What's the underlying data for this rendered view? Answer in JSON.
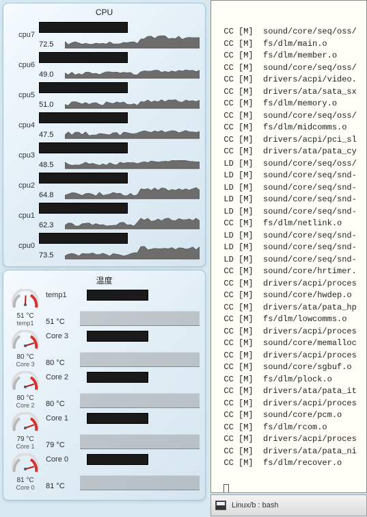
{
  "cpu_widget": {
    "title": "CPU",
    "rows": [
      {
        "label": "cpu7",
        "value": "72.5"
      },
      {
        "label": "cpu6",
        "value": "49.0"
      },
      {
        "label": "cpu5",
        "value": "51.0"
      },
      {
        "label": "cpu4",
        "value": "47.5"
      },
      {
        "label": "cpu3",
        "value": "48.5"
      },
      {
        "label": "cpu2",
        "value": "64.8"
      },
      {
        "label": "cpu1",
        "value": "62.3"
      },
      {
        "label": "cpu0",
        "value": "73.5"
      }
    ]
  },
  "temp_widget": {
    "title": "温度",
    "rows": [
      {
        "gauge_value": "51 °C",
        "gauge_label": "temp1",
        "name": "temp1",
        "graph_value": "51 °C"
      },
      {
        "gauge_value": "80 °C",
        "gauge_label": "Core 3",
        "name": "Core 3",
        "graph_value": "80 °C"
      },
      {
        "gauge_value": "80 °C",
        "gauge_label": "Core 2",
        "name": "Core 2",
        "graph_value": "80 °C"
      },
      {
        "gauge_value": "79 °C",
        "gauge_label": "Core 1",
        "name": "Core 1",
        "graph_value": "79 °C"
      },
      {
        "gauge_value": "81 °C",
        "gauge_label": "Core 0",
        "name": "Core 0",
        "graph_value": "81 °C"
      }
    ]
  },
  "terminal": {
    "lines": [
      "  CC [M]  sound/core/seq/oss/",
      "  CC [M]  fs/dlm/main.o",
      "  CC [M]  fs/dlm/member.o",
      "  CC [M]  sound/core/seq/oss/",
      "  CC [M]  drivers/acpi/video.",
      "  CC [M]  drivers/ata/sata_sx",
      "  CC [M]  fs/dlm/memory.o",
      "  CC [M]  sound/core/seq/oss/",
      "  CC [M]  fs/dlm/midcomms.o",
      "  CC [M]  drivers/acpi/pci_sl",
      "  CC [M]  drivers/ata/pata_cy",
      "  LD [M]  sound/core/seq/oss/",
      "  LD [M]  sound/core/seq/snd-",
      "  LD [M]  sound/core/seq/snd-",
      "  LD [M]  sound/core/seq/snd-",
      "  LD [M]  sound/core/seq/snd-",
      "  CC [M]  fs/dlm/netlink.o",
      "  LD [M]  sound/core/seq/snd-",
      "  LD [M]  sound/core/seq/snd-",
      "  LD [M]  sound/core/seq/snd-",
      "  CC [M]  sound/core/hrtimer.",
      "  CC [M]  drivers/acpi/proces",
      "  CC [M]  sound/core/hwdep.o",
      "  CC [M]  drivers/ata/pata_hp",
      "  CC [M]  fs/dlm/lowcomms.o",
      "  CC [M]  drivers/acpi/proces",
      "  CC [M]  sound/core/memalloc",
      "  CC [M]  drivers/acpi/proces",
      "  CC [M]  sound/core/sgbuf.o",
      "  CC [M]  fs/dlm/plock.o",
      "  CC [M]  drivers/ata/pata_it",
      "  CC [M]  drivers/acpi/proces",
      "  CC [M]  sound/core/pcm.o",
      "  CC [M]  fs/dlm/rcom.o",
      "  CC [M]  drivers/acpi/proces",
      "  CC [M]  drivers/ata/pata_ni",
      "  CC [M]  fs/dlm/recover.o"
    ]
  },
  "taskbar": {
    "title": "Linux/b : bash"
  },
  "chart_data": [
    {
      "type": "line",
      "title": "CPU usage history",
      "ylabel": "%",
      "ylim": [
        0,
        100
      ],
      "series": [
        {
          "name": "cpu7",
          "current": 72.5
        },
        {
          "name": "cpu6",
          "current": 49.0
        },
        {
          "name": "cpu5",
          "current": 51.0
        },
        {
          "name": "cpu4",
          "current": 47.5
        },
        {
          "name": "cpu3",
          "current": 48.5
        },
        {
          "name": "cpu2",
          "current": 64.8
        },
        {
          "name": "cpu1",
          "current": 62.3
        },
        {
          "name": "cpu0",
          "current": 73.5
        }
      ]
    },
    {
      "type": "line",
      "title": "Temperature history",
      "ylabel": "°C",
      "ylim": [
        0,
        100
      ],
      "series": [
        {
          "name": "temp1",
          "current": 51
        },
        {
          "name": "Core 3",
          "current": 80
        },
        {
          "name": "Core 2",
          "current": 80
        },
        {
          "name": "Core 1",
          "current": 79
        },
        {
          "name": "Core 0",
          "current": 81
        }
      ]
    }
  ]
}
